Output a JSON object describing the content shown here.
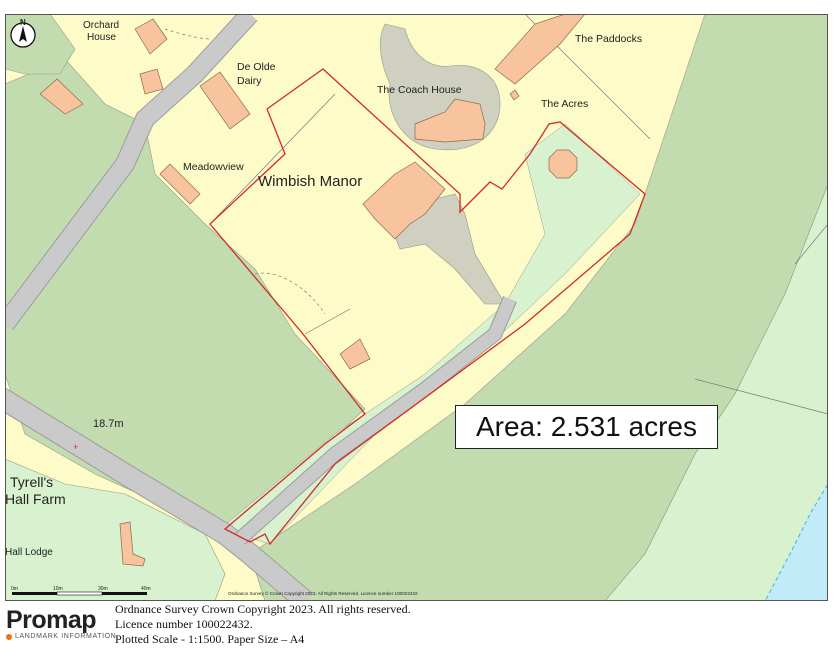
{
  "map": {
    "north_letter": "N",
    "labels": {
      "orchard_house_1": "Orchard",
      "orchard_house_2": "House",
      "de_olde_1": "De Olde",
      "de_olde_2": "Dairy",
      "coach_house": "The Coach House",
      "paddocks": "The Paddocks",
      "acres": "The Acres",
      "meadowview": "Meadowview",
      "wimbish_manor": "Wimbish Manor",
      "spot_height": "18.7m",
      "tyrells_1": "Tyrell's",
      "tyrells_2": "Hall Farm",
      "hall_lodge": "Hall Lodge"
    },
    "scale_bar": {
      "ticks": [
        "0m",
        "10m",
        "30m",
        "40m"
      ]
    },
    "os_notice": "Ordnance Survey © Crown Copyright 2023. All Rights Reserved. Licence number 100022432",
    "area_label": "Area: 2.531 acres",
    "colors": {
      "residential": "#fdfbc8",
      "field_green": "#c2dcb0",
      "field_light": "#d8f2cf",
      "road": "#c8c8c8",
      "building": "#f7c49d",
      "boundary": "#d42a2a",
      "water": "#c2ebfa"
    }
  },
  "footer": {
    "logo_word": "Promap",
    "logo_sub": "LANDMARK INFORMATION",
    "line1": "Ordnance Survey Crown Copyright 2023. All rights reserved.",
    "line2": "Licence number 100022432.",
    "line3": "Plotted Scale - 1:1500. Paper Size – A4"
  }
}
